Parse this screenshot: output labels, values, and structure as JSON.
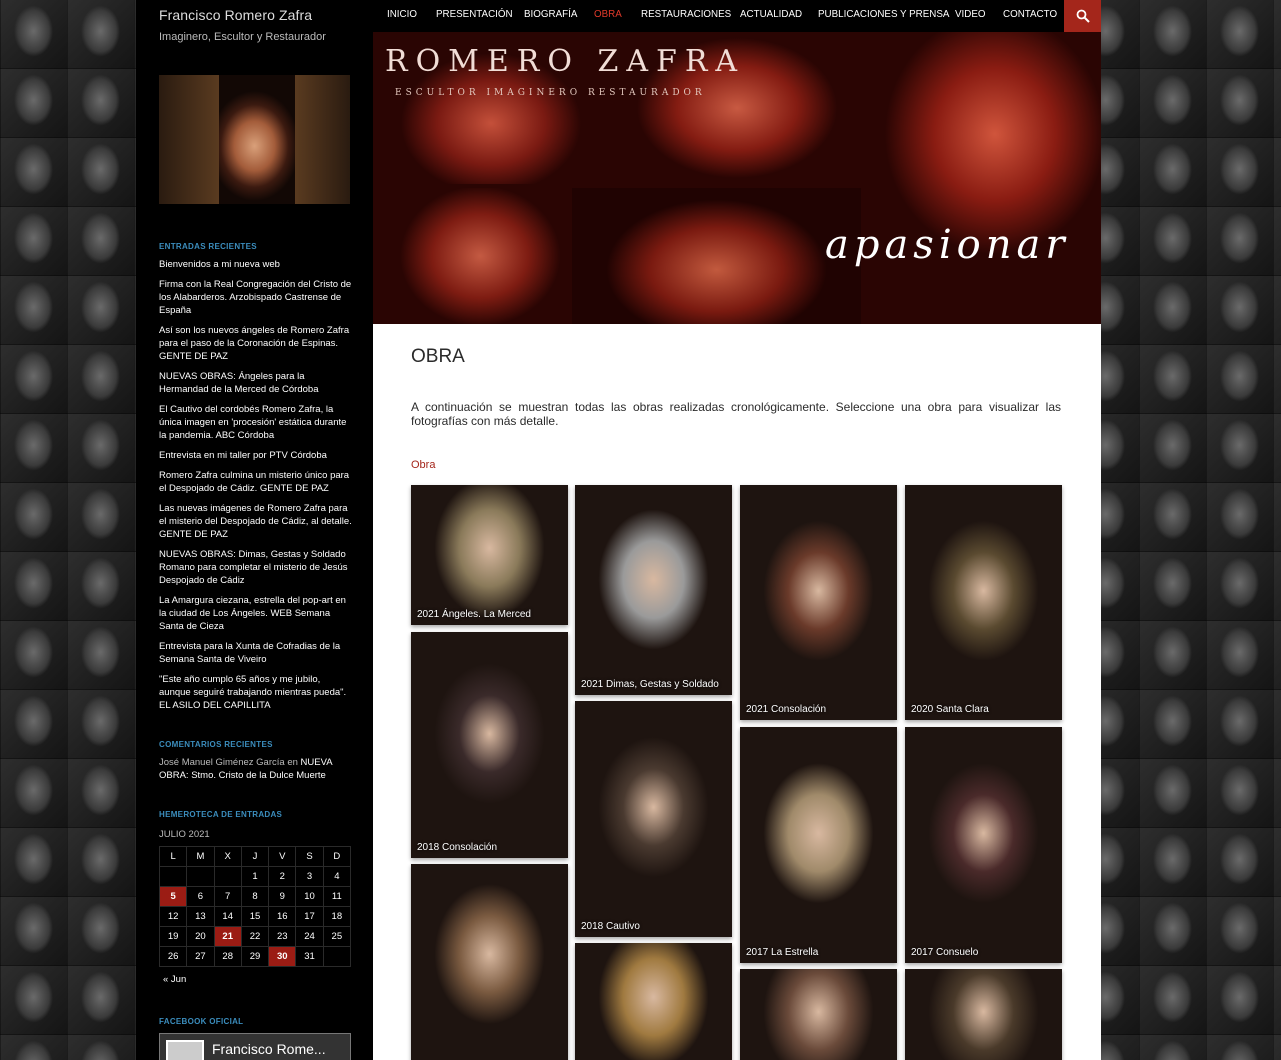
{
  "site": {
    "title": "Francisco Romero Zafra",
    "description": "Imaginero, Escultor y Restaurador"
  },
  "nav": {
    "items": [
      "INICIO",
      "PRESENTACIÓN",
      "BIOGRAFÍA",
      "OBRA",
      "RESTAURACIONES",
      "ACTUALIDAD",
      "PUBLICACIONES Y PRENSA",
      "VIDEO",
      "CONTACTO"
    ],
    "active": "OBRA",
    "search_icon": "search-icon"
  },
  "banner": {
    "logo": "ROMERO ZAFRA",
    "subtitle": "ESCULTOR IMAGINERO RESTAURADOR",
    "word": "apasionar"
  },
  "sidebar": {
    "recent_title": "ENTRADAS RECIENTES",
    "recent_posts": [
      "Bienvenidos a mi nueva web",
      "Firma con la Real Congregación del Cristo de los Alabarderos. Arzobispado Castrense de España",
      "Así son los nuevos ángeles de Romero Zafra para el paso de la Coronación de Espinas. GENTE DE PAZ",
      "NUEVAS OBRAS: Ángeles para la Hermandad de la Merced de Córdoba",
      "El Cautivo del cordobés Romero Zafra, la única imagen en 'procesión' estática durante la pandemia. ABC Córdoba",
      "Entrevista en mi taller por PTV Córdoba",
      "Romero Zafra culmina un misterio único para el Despojado de Cádiz. GENTE DE PAZ",
      "Las nuevas imágenes de Romero Zafra para el misterio del Despojado de Cádiz, al detalle. GENTE DE PAZ",
      "NUEVAS OBRAS: Dimas, Gestas y Soldado Romano para completar el misterio de Jesús Despojado de Cádiz",
      "La Amargura ciezana, estrella del pop-art en la ciudad de Los Ángeles. WEB Semana Santa de Cieza",
      "Entrevista para la Xunta de Cofradias de la Semana Santa de Viveiro",
      "\"Este año cumplo 65 años y me jubilo, aunque seguiré trabajando mientras pueda\". EL ASILO DEL CAPILLITA"
    ],
    "comments_title": "COMENTARIOS RECIENTES",
    "comment_author": "José Manuel Giménez García",
    "comment_connector": "en",
    "comment_post": "NUEVA OBRA: Stmo. Cristo de la Dulce Muerte",
    "archive_title": "HEMEROTECA DE ENTRADAS",
    "calendar": {
      "caption": "JULIO 2021",
      "days": [
        "L",
        "M",
        "X",
        "J",
        "V",
        "S",
        "D"
      ],
      "weeks": [
        [
          "",
          "",
          "",
          "1",
          "2",
          "3",
          "4"
        ],
        [
          "5",
          "6",
          "7",
          "8",
          "9",
          "10",
          "11"
        ],
        [
          "12",
          "13",
          "14",
          "15",
          "16",
          "17",
          "18"
        ],
        [
          "19",
          "20",
          "21",
          "22",
          "23",
          "24",
          "25"
        ],
        [
          "26",
          "27",
          "28",
          "29",
          "30",
          "31",
          ""
        ]
      ],
      "linked_days": [
        "5",
        "21",
        "30"
      ],
      "prev": "« Jun"
    },
    "facebook_title": "FACEBOOK OFICIAL",
    "facebook_name": "Francisco Rome..."
  },
  "content": {
    "title": "OBRA",
    "intro": "A continuación se muestran todas las obras realizadas cronológicamente. Seleccione una obra para visualizar las fotografías con más detalle.",
    "category_link": "Obra",
    "works": [
      {
        "caption": "2021 Ángeles. La Merced",
        "color": "#8a7a5a"
      },
      {
        "caption": "2021 Dimas, Gestas y Soldado",
        "color": "#9a9a9a"
      },
      {
        "caption": "2021 Consolación",
        "color": "#6a3a2a"
      },
      {
        "caption": "2020 Santa Clara",
        "color": "#5a4a30"
      },
      {
        "caption": "2018 Consolación",
        "color": "#3a2a2a"
      },
      {
        "caption": "2018 Cautivo",
        "color": "#4a3a30"
      },
      {
        "caption": "2017 La Estrella",
        "color": "#a08a6a"
      },
      {
        "caption": "2017 Consuelo",
        "color": "#4a2a2a"
      },
      {
        "caption": "",
        "color": "#7a5a40"
      },
      {
        "caption": "",
        "color": "#a07a40"
      },
      {
        "caption": "",
        "color": "#6a4a3a"
      },
      {
        "caption": "",
        "color": "#4a3a2a"
      }
    ]
  }
}
